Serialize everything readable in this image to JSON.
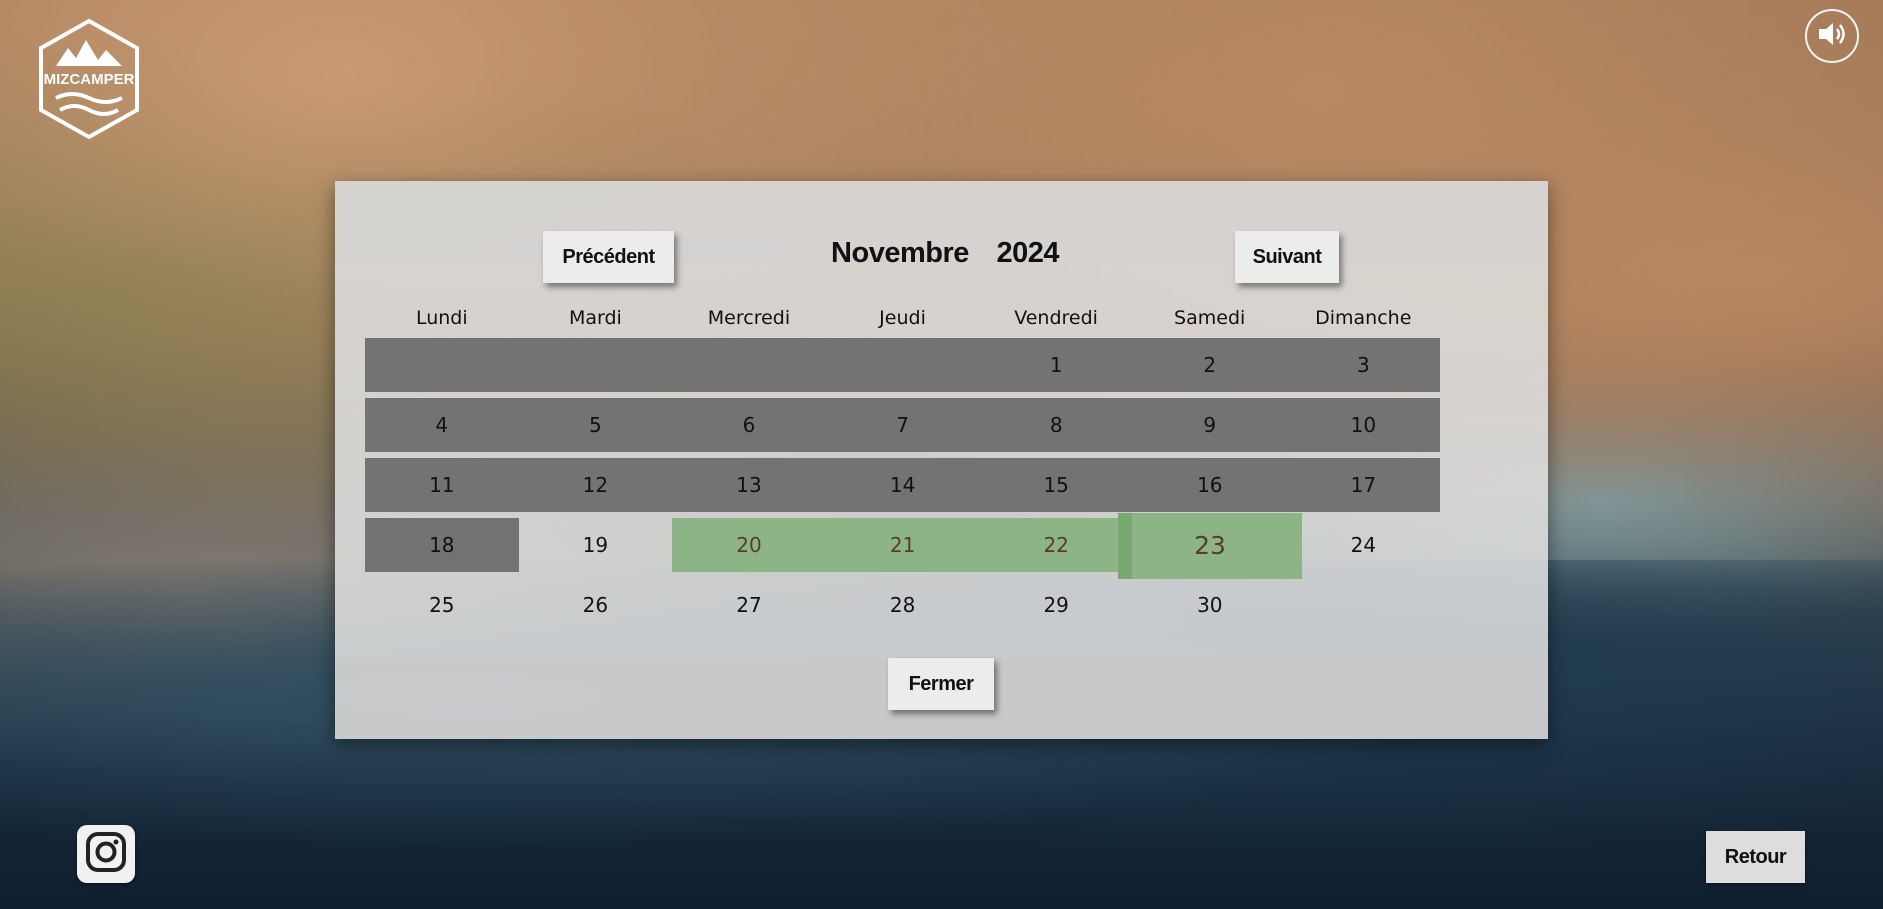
{
  "brand": {
    "logo_text": "MIZCAMPER"
  },
  "calendar": {
    "prev_label": "Précédent",
    "next_label": "Suivant",
    "month": "Novembre",
    "year": "2024",
    "close_label": "Fermer",
    "weekdays": [
      "Lundi",
      "Mardi",
      "Mercredi",
      "Jeudi",
      "Vendredi",
      "Samedi",
      "Dimanche"
    ],
    "weeks": [
      [
        "",
        "",
        "",
        "",
        "1",
        "2",
        "3"
      ],
      [
        "4",
        "5",
        "6",
        "7",
        "8",
        "9",
        "10"
      ],
      [
        "11",
        "12",
        "13",
        "14",
        "15",
        "16",
        "17"
      ],
      [
        "18",
        "19",
        "20",
        "21",
        "22",
        "23",
        "24"
      ],
      [
        "25",
        "26",
        "27",
        "28",
        "29",
        "30",
        ""
      ]
    ],
    "unavailable_until": "18",
    "selected_range": [
      "20",
      "21",
      "22",
      "23"
    ],
    "colors": {
      "unavailable": "#737373",
      "selected": "#8db486",
      "selected_text": "#5a3b2a"
    }
  },
  "footer": {
    "retour_label": "Retour"
  },
  "icons": {
    "sound": "speaker-icon",
    "social": "instagram-icon"
  }
}
